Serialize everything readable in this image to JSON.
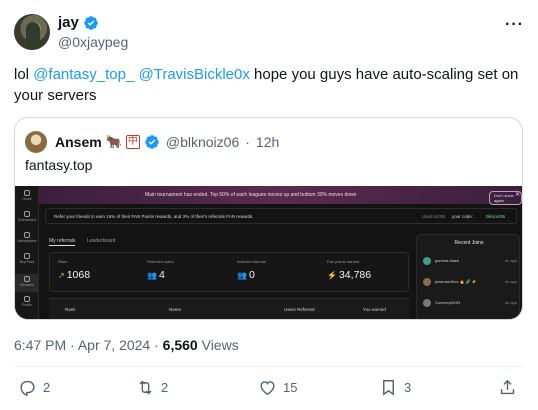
{
  "tweet": {
    "user_name": "jay",
    "handle": "@0xjaypeg",
    "text_prefix": "lol ",
    "mention_1": "@fantasy_top_",
    "mention_2": "@TravisBickle0x",
    "text_suffix": " hope you guys have auto-scaling set on your servers",
    "more_icon": "···"
  },
  "quote": {
    "user_name": "Ansem",
    "emoji_1": "🐂",
    "emoji_2": "中",
    "handle": "@blknoiz06",
    "sep": "·",
    "time": "12h",
    "text": "fantasy.top",
    "screenshot": {
      "sidebar": [
        "Home",
        "Tournament",
        "Marketplace",
        "Buy Pack",
        "Rewards",
        "Profile"
      ],
      "banner_text": "Main tournament has ended. Top 50% of each leagues moves up and bottom 30% moves down",
      "banner_button": "Don't show again",
      "banner_close": "✕",
      "referral_text": "Refer your friends to earn 15% of their FAN Points rewards, and 3% of their's referrals FAN rewards.",
      "referral_used": "Used 4/100",
      "referral_code_label": "your code:",
      "referral_code": "blknoiz06",
      "tab_active": "My referrals",
      "tab_other": "Leaderboard",
      "stats": [
        {
          "label": "Rank",
          "symbol": "↗",
          "value": "1068"
        },
        {
          "label": "Referred users",
          "symbol": "👥",
          "value": "4"
        },
        {
          "label": "Indirect referrals",
          "symbol": "👥",
          "value": "0"
        },
        {
          "label": "Fan points earned",
          "symbol": "⚡",
          "value": "34,786"
        }
      ],
      "table_headers": [
        "Rank",
        "Name",
        "Users Referred",
        "You earned"
      ],
      "recent_title": "Recent Joins",
      "recent_joins": [
        {
          "name": "gamma blaze",
          "time": "5s ago",
          "color": "#3a9d8f"
        },
        {
          "name": "pinsmanJims 🔥 🔗 ⚡",
          "time": "5s ago",
          "color": "#8b6b4a"
        },
        {
          "name": "CurrencyNON",
          "time": "5s ago",
          "color": "#7a7a7a"
        }
      ]
    }
  },
  "meta": {
    "time": "6:47 PM",
    "sep1": "·",
    "date": "Apr 7, 2024",
    "sep2": "·",
    "views_count": "6,560",
    "views_label": "Views"
  },
  "actions": {
    "replies": "2",
    "reposts": "2",
    "likes": "15",
    "bookmarks": "3"
  },
  "colors": {
    "accent": "#1d9bf0",
    "secondary_text": "#536471",
    "border": "#cfd9de"
  }
}
